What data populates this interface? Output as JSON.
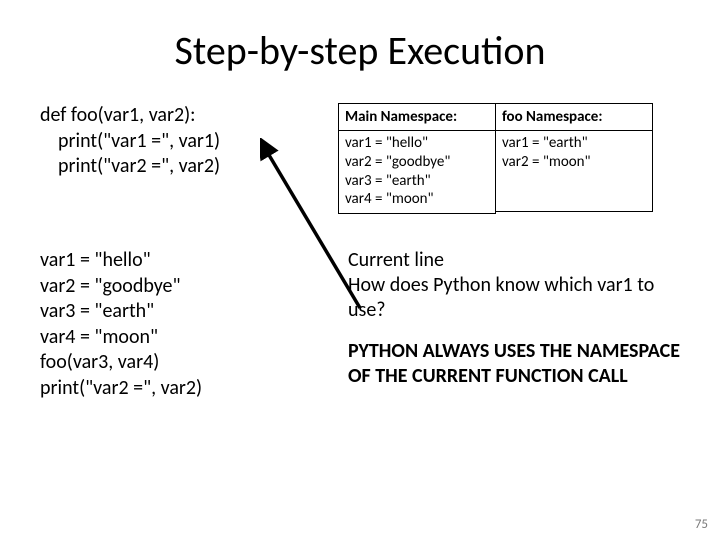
{
  "title": "Step-by-step Execution",
  "code": {
    "l1": "def foo(var1, var2):",
    "l2": "print(\"var1 =\", var1)",
    "l3": "print(\"var2 =\", var2)",
    "b1": "var1 = \"hello\"",
    "b2": "var2 = \"goodbye\"",
    "b3": "var3 = \"earth\"",
    "b4": "var4 = \"moon\"",
    "b5": "foo(var3, var4)",
    "b6": "print(\"var2 =\", var2)"
  },
  "ns": {
    "main_header": "Main Namespace:",
    "foo_header": "foo Namespace:",
    "main_body": "var1 = \"hello\"\nvar2 = \"goodbye\"\nvar3 = \"earth\"\nvar4 = \"moon\"",
    "foo_body": "var1 = \"earth\"\nvar2 = \"moon\""
  },
  "note": {
    "l1": "Current line",
    "l2": "How does Python know which var1 to use?",
    "caps": "PYTHON ALWAYS USES THE NAMESPACE OF THE CURRENT FUNCTION CALL"
  },
  "page": "75"
}
